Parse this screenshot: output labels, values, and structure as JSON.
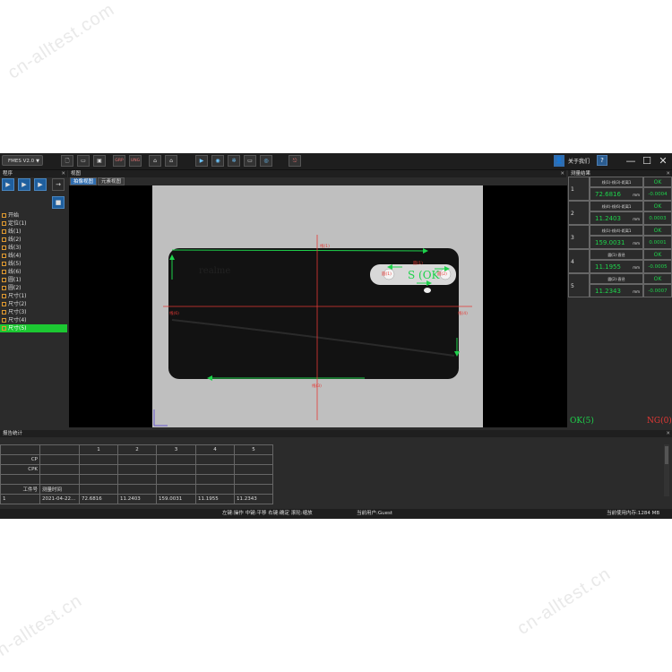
{
  "app": {
    "version_select": "FMES V2.0"
  },
  "watermarks": [
    "cn-alltest.com",
    "cn-alltest.cn",
    "cn-alltest.cn"
  ],
  "header": {
    "about_label": "关于我们",
    "help_label": "?",
    "min_label": "—",
    "max_label": "☐",
    "close_label": "✕"
  },
  "toolbar": {
    "btn_grp": "GRP",
    "btn_ung": "UNG"
  },
  "panels": {
    "program_title": "程序",
    "view_title": "视图",
    "results_title": "测量结果",
    "report_title": "报告统计"
  },
  "program": {
    "items": [
      {
        "label": "开始"
      },
      {
        "label": "定位(1)"
      },
      {
        "label": "线(1)"
      },
      {
        "label": "线(2)"
      },
      {
        "label": "线(3)"
      },
      {
        "label": "线(4)"
      },
      {
        "label": "线(5)"
      },
      {
        "label": "线(6)"
      },
      {
        "label": "圆(1)"
      },
      {
        "label": "圆(2)"
      },
      {
        "label": "尺寸(1)"
      },
      {
        "label": "尺寸(2)"
      },
      {
        "label": "尺寸(3)"
      },
      {
        "label": "尺寸(4)"
      },
      {
        "label": "尺寸(5)"
      }
    ],
    "selected_index": 14
  },
  "view": {
    "tabs": [
      {
        "label": "拍像视图"
      },
      {
        "label": "元素视图"
      }
    ],
    "active_tab": 0,
    "overlay_labels": {
      "top": "线(1)",
      "left": "线(6)",
      "right": "线(4)",
      "bottom": "线(3)",
      "circle_left": "圆(1)",
      "circle_right": "圆(2)",
      "circle_mid": "圆(1)"
    },
    "sample_text": "realme",
    "camera_text": "S (OK"
  },
  "results": [
    {
      "index": "1",
      "name": "线(1)-线(3)-距离1",
      "value": "72.6816",
      "unit": "mm",
      "status": "OK",
      "deviation": "-0.0004"
    },
    {
      "index": "2",
      "name": "线(4)-线(6)-距离1",
      "value": "11.2403",
      "unit": "mm",
      "status": "OK",
      "deviation": "0.0003"
    },
    {
      "index": "3",
      "name": "线(1)-线(4)-距离1",
      "value": "159.0031",
      "unit": "mm",
      "status": "OK",
      "deviation": "0.0001"
    },
    {
      "index": "4",
      "name": "圆(1)-直径",
      "value": "11.1955",
      "unit": "mm",
      "status": "OK",
      "deviation": "-0.0005"
    },
    {
      "index": "5",
      "name": "圆(2)-直径",
      "value": "11.2343",
      "unit": "mm",
      "status": "OK",
      "deviation": "-0.0007"
    }
  ],
  "summary": {
    "ok": "OK(5)",
    "ng": "NG(0)"
  },
  "report": {
    "columns": [
      "",
      "",
      "1",
      "2",
      "3",
      "4",
      "5"
    ],
    "rows": [
      [
        "CP",
        "",
        "",
        "",
        "",
        "",
        ""
      ],
      [
        "CPK",
        "",
        "",
        "",
        "",
        "",
        ""
      ],
      [
        "",
        "",
        "",
        "",
        "",
        "",
        ""
      ],
      [
        "工件号",
        "测量时间",
        "",
        "",
        "",
        "",
        ""
      ],
      [
        "1",
        "2021-04-22...",
        "72.6816",
        "11.2403",
        "159.0031",
        "11.1955",
        "11.2343"
      ]
    ]
  },
  "status": {
    "hint": "左键:操作  中键:平移  右键:确定  滚轮:缩放",
    "user": "当前用户:Guest",
    "memory": "当前使用内存:1284 MB"
  },
  "colors": {
    "accent": "#2f6db0",
    "ok": "#1ed24b",
    "ng": "#e53935",
    "selected": "#1cc832"
  }
}
